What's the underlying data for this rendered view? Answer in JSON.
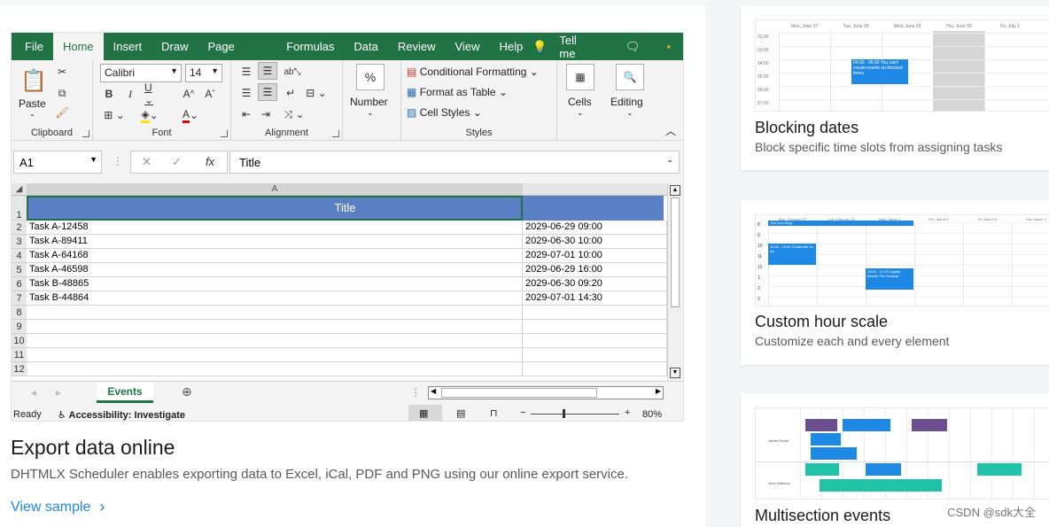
{
  "excel": {
    "ribbon_tabs": [
      "File",
      "Home",
      "Insert",
      "Draw",
      "Page Layout",
      "Formulas",
      "Data",
      "Review",
      "View",
      "Help"
    ],
    "active_tab": "Home",
    "tell_me": "Tell me",
    "clipboard": {
      "paste": "Paste",
      "label": "Clipboard"
    },
    "font": {
      "name": "Calibri",
      "size": "14",
      "label": "Font"
    },
    "alignment": {
      "label": "Alignment"
    },
    "number": {
      "label": "Number",
      "icon_text": "%"
    },
    "styles": {
      "conditional": "Conditional Formatting",
      "format_table": "Format as Table",
      "cell_styles": "Cell Styles",
      "label": "Styles"
    },
    "cells": {
      "label": "Cells"
    },
    "editing": {
      "label": "Editing"
    },
    "name_box": "A1",
    "formula_value": "Title",
    "fx": "fx",
    "column_a": "A",
    "title_cell": "Title",
    "rows": [
      {
        "n": "1"
      },
      {
        "n": "2",
        "a": "Task A-12458",
        "b": "2029-06-29 09:00"
      },
      {
        "n": "3",
        "a": "Task A-89411",
        "b": "2029-06-30 10:00"
      },
      {
        "n": "4",
        "a": "Task A-64168",
        "b": "2029-07-01 10:00"
      },
      {
        "n": "5",
        "a": "Task A-46598",
        "b": "2029-06-29 16:00"
      },
      {
        "n": "6",
        "a": "Task B-48865",
        "b": "2029-06-30 09:20"
      },
      {
        "n": "7",
        "a": "Task B-44864",
        "b": "2029-07-01 14:30"
      },
      {
        "n": "8"
      },
      {
        "n": "9"
      },
      {
        "n": "10"
      },
      {
        "n": "11"
      },
      {
        "n": "12"
      }
    ],
    "sheet_tab": "Events",
    "status_ready": "Ready",
    "accessibility": "Accessibility: Investigate",
    "zoom": "80%"
  },
  "main_card": {
    "title": "Export data online",
    "description": "DHTMLX Scheduler enables exporting data to Excel, iCal, PDF and PNG using our online export service.",
    "link": "View sample"
  },
  "side_cards": [
    {
      "title": "Blocking dates",
      "description": "Block specific time slots from assigning tasks",
      "thumb_days": [
        "Mon, June 27",
        "Tue, June 28",
        "Wed, June 29",
        "Thu, June 30",
        "Fri, July 1"
      ],
      "thumb_hours": [
        "02:00",
        "03:00",
        "04:00",
        "05:00",
        "06:00",
        "07:00"
      ],
      "thumb_event": "04:00 - 06:00 You can't create events on blocked times"
    },
    {
      "title": "Custom hour scale",
      "description": "Customize each and every element",
      "thumb_days": [
        "Mon, February 27",
        "Tue, February 28",
        "Wed, March 1",
        "Thu, March 2",
        "Fri, March 3",
        "Sat, March 4"
      ],
      "thumb_hours": [
        "8",
        "9",
        "10",
        "11",
        "12",
        "1",
        "2",
        "3"
      ],
      "thumb_events": [
        "The Lion King",
        "10:00 - 12:00 Cinderella On Ice",
        "13:00 - 14:15 Legally Blonde The Musical"
      ]
    },
    {
      "title": "Multisection events",
      "description": "",
      "thumb_people": [
        "James Smith",
        "John Williams"
      ]
    }
  ],
  "watermark": "CSDN @sdk大全",
  "colors": {
    "excel_green": "#217346",
    "title_fill": "#5b7fc4",
    "link": "#1d88e5"
  }
}
